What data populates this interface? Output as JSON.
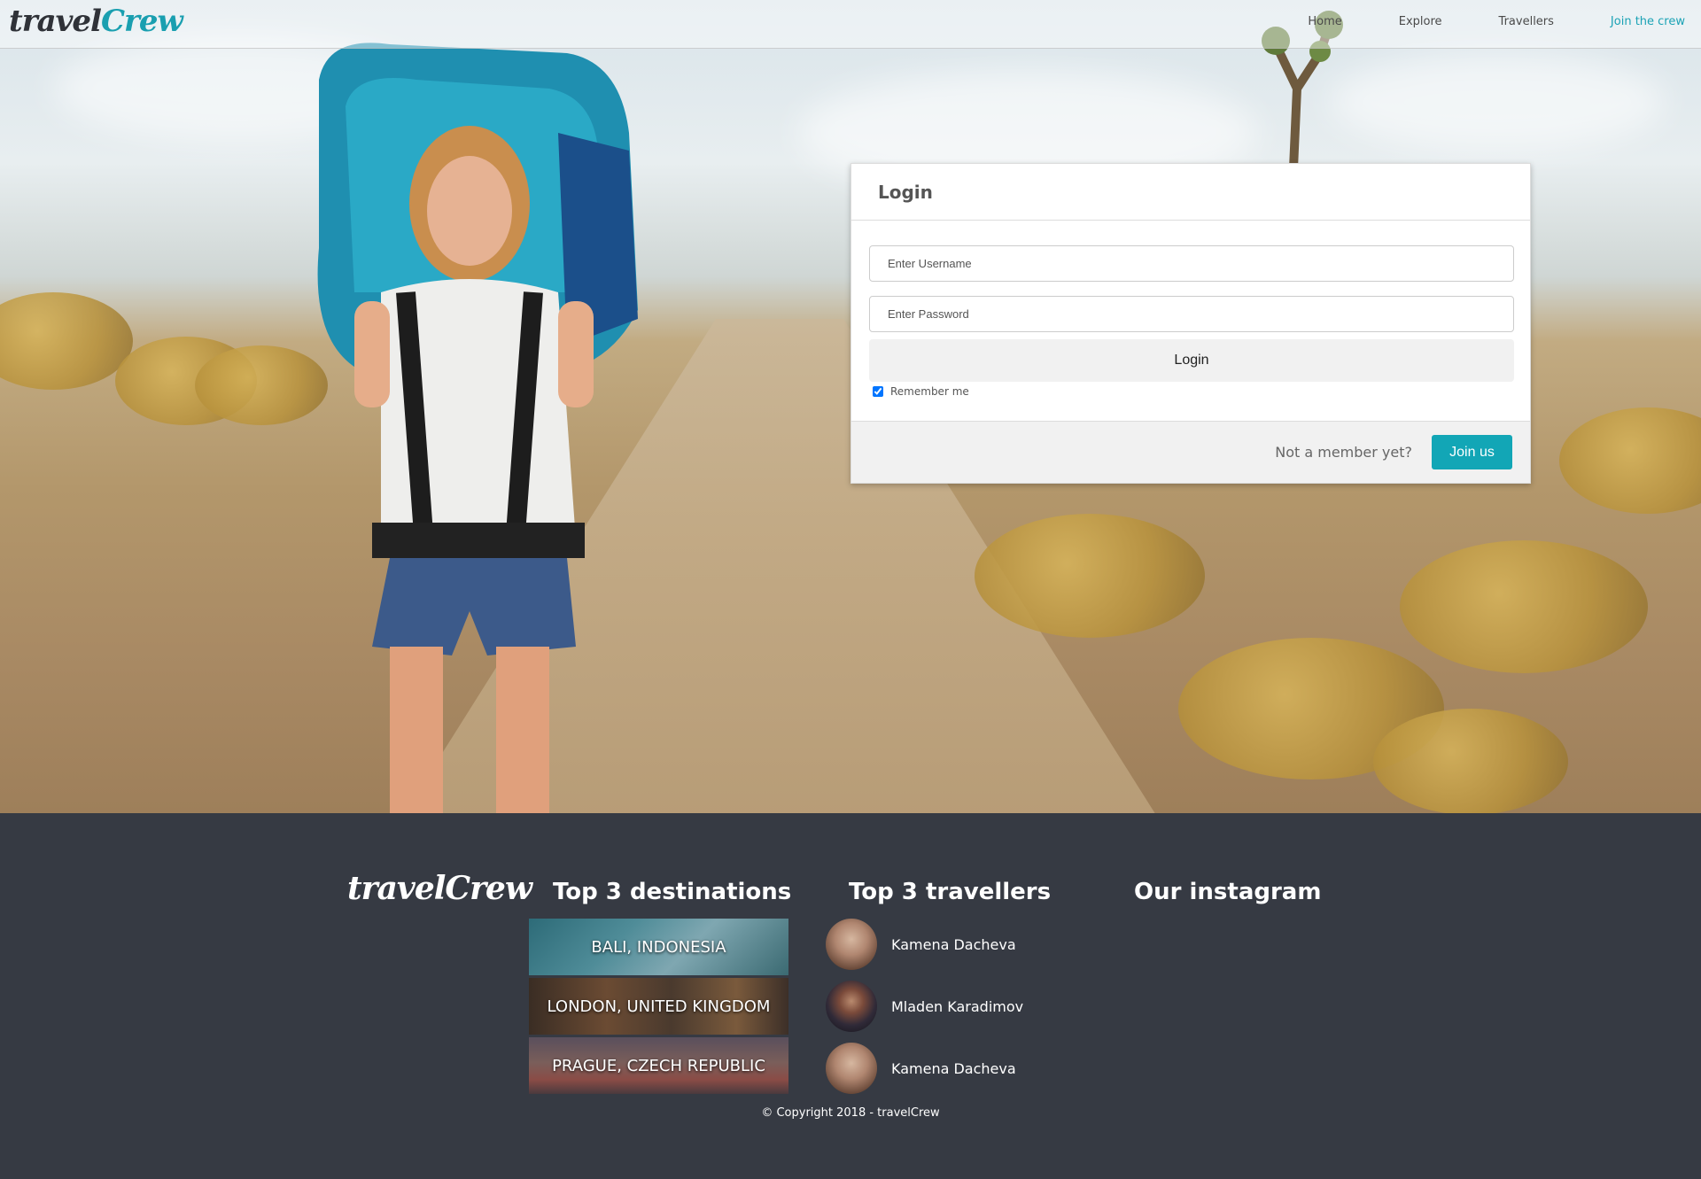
{
  "brand": {
    "logo_part1": "travel",
    "logo_part2": "Crew",
    "accent_color": "#1aa2b5"
  },
  "nav": {
    "items": [
      {
        "label": "Home"
      },
      {
        "label": "Explore"
      },
      {
        "label": "Travellers"
      },
      {
        "label": "Join the crew"
      }
    ]
  },
  "login": {
    "title": "Login",
    "username_placeholder": "Enter Username",
    "password_placeholder": "Enter Password",
    "button_label": "Login",
    "remember_label": "Remember me",
    "remember_checked": true,
    "not_member_text": "Not a member yet?",
    "join_button_label": "Join us"
  },
  "footer": {
    "logo": "travelCrew",
    "destinations_heading": "Top 3 destinations",
    "destinations": [
      {
        "label": "BALI, INDONESIA"
      },
      {
        "label": "LONDON, UNITED KINGDOM"
      },
      {
        "label": "PRAGUE, CZECH REPUBLIC"
      }
    ],
    "travellers_heading": "Top 3 travellers",
    "travellers": [
      {
        "name": "Kamena Dacheva"
      },
      {
        "name": "Mladen Karadimov"
      },
      {
        "name": "Kamena Dacheva"
      }
    ],
    "instagram_heading": "Our instagram",
    "copyright": "© Copyright 2018 - travelCrew",
    "background_color": "#363a43"
  }
}
